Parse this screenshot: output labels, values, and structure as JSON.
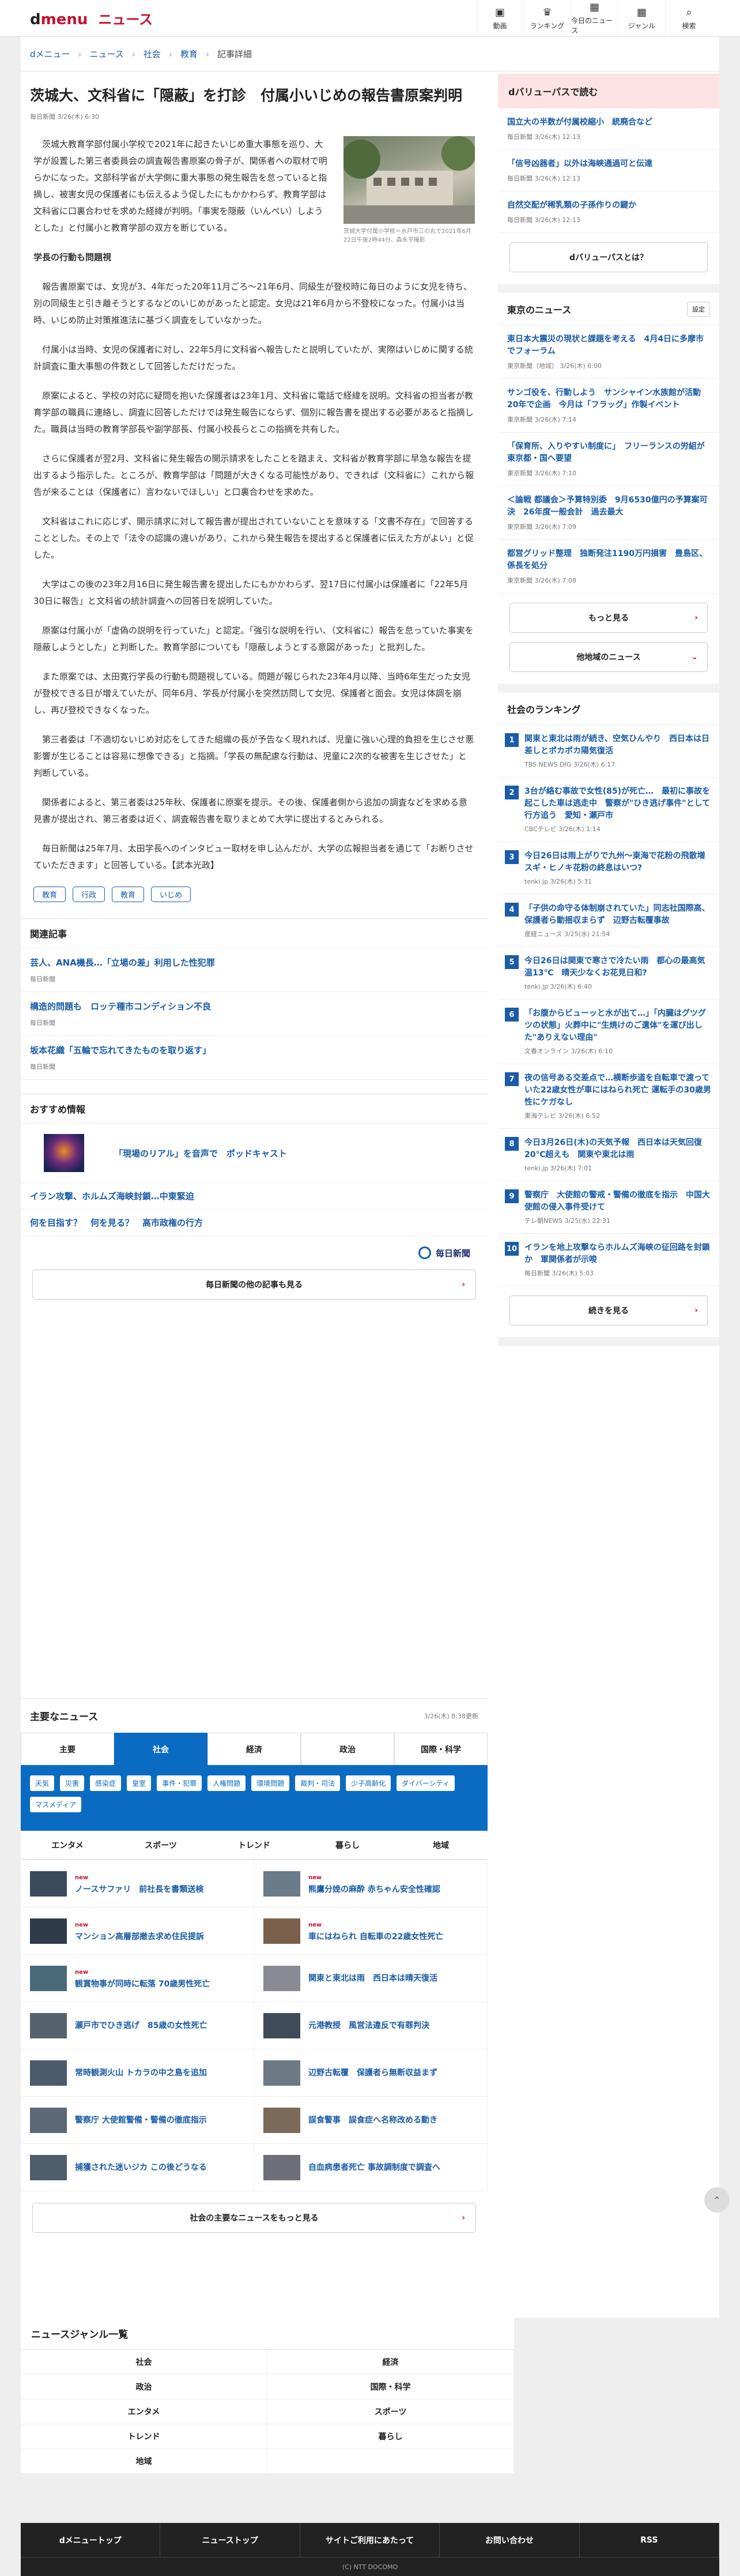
{
  "header": {
    "logo_d": "d",
    "logo_menu": "menu",
    "logo_news": "ニュース",
    "nav": [
      {
        "icon": "tv-icon",
        "glyph": "▣",
        "label": "動画"
      },
      {
        "icon": "trophy-icon",
        "glyph": "♛",
        "label": "ランキング"
      },
      {
        "icon": "calendar-icon",
        "glyph": "▦",
        "label": "今日のニュース"
      },
      {
        "icon": "grid-icon",
        "glyph": "▦",
        "label": "ジャンル"
      },
      {
        "icon": "search-icon",
        "glyph": "⌕",
        "label": "検索"
      }
    ]
  },
  "breadcrumb": [
    "dメニュー",
    "ニュース",
    "社会",
    "教育",
    "記事詳細"
  ],
  "article": {
    "title": "茨城大、文科省に「隠蔽」を打診　付属小いじめの報告書原案判明",
    "meta": "毎日新聞  3/26(木) 6:30",
    "caption": "茨城大学付属小学校＝水戸市三の丸で2021年6月22日午後2時44分、森永亨撮影",
    "paras": [
      "茨城大教育学部付属小学校で2021年に起きたいじめ重大事態を巡り、大学が設置した第三者委員会の調査報告書原案の骨子が、関係者への取材で明らかになった。文部科学省が大学側に重大事態の発生報告を怠っていると指摘し、被害女児の保護者にも伝えるよう促したにもかかわらず、教育学部は文科省に口裏合わせを求めた経緯が判明。「事実を隠蔽（いんぺい）しようとした」と付属小と教育学部の双方を断じている。",
      "学長の行動も問題視",
      "報告書原案では、女児が3、4年だった20年11月ごろ～21年6月、同級生が登校時に毎日のように女児を待ち、別の同級生と引き離そうとするなどのいじめがあったと認定。女児は21年6月から不登校になった。付属小は当時、いじめ防止対策推進法に基づく調査をしていなかった。",
      "付属小は当時、女児の保護者に対し、22年5月に文科省へ報告したと説明していたが、実際はいじめに関する統計調査に重大事態の件数として回答しただけだった。",
      "原案によると、学校の対応に疑問を抱いた保護者は23年1月、文科省に電話で経緯を説明。文科省の担当者が教育学部の職員に連絡し、調査に回答しただけでは発生報告にならず、個別に報告書を提出する必要があると指摘した。職員は当時の教育学部長や副学部長、付属小校長らとこの指摘を共有した。",
      "さらに保護者が翌2月、文科省に発生報告の開示請求をしたことを踏まえ、文科省が教育学部に早急な報告を提出するよう指示した。ところが、教育学部は「問題が大きくなる可能性があり、できれば（文科省に）これから報告が来ることは（保護者に）言わないでほしい」と口裏合わせを求めた。",
      "文科省はこれに応じず、開示請求に対して報告書が提出されていないことを意味する「文書不存在」で回答することとした。その上で「法令の認識の違いがあり、これから発生報告を提出すると保護者に伝えた方がよい」と促した。",
      "大学はこの後の23年2月16日に発生報告書を提出したにもかかわらず、翌17日に付属小は保護者に「22年5月30日に報告」と文科省の統計調査への回答日を説明していた。",
      "原案は付属小が「虚偽の説明を行っていた」と認定。「強引な説明を行い、（文科省に）報告を怠っていた事実を隠蔽しようとした」と判断した。教育学部についても「隠蔽しようとする意図があった」と批判した。",
      "また原案では、太田寛行学長の行動も問題視している。問題が報じられた23年4月以降、当時6年生だった女児が登校できる日が増えていたが、同年6月、学長が付属小を突然訪問して女児、保護者と面会。女児は体調を崩し、再び登校できなくなった。",
      "第三者委は「不適切ないじめ対応をしてきた組織の長が予告なく現れれば、児童に強い心理的負担を生じさせ悪影響が生じることは容易に想像できる」と指摘。「学長の無配慮な行動は、児童に2次的な被害を生じさせた」と判断している。",
      "関係者によると、第三者委は25年秋、保護者に原案を提示。その後、保護者側から追加の調査などを求める意見書が提出され、第三者委は近く、調査報告書を取りまとめて大学に提出するとみられる。",
      "毎日新聞は25年7月、太田学長へのインタビュー取材を申し込んだが、大学の広報担当者を通じて「お断りさせていただきます」と回答している。【武本光政】"
    ],
    "tags": [
      "教育",
      "行政",
      "教育",
      "いじめ"
    ]
  },
  "related": {
    "heading": "関連記事",
    "items": [
      {
        "title": "芸人、ANA機長…「立場の差」利用した性犯罪",
        "source": "毎日新聞"
      },
      {
        "title": "構造的問題も　ロッテ種市コンディション不良",
        "source": "毎日新聞"
      },
      {
        "title": "坂本花織「五輪で忘れてきたものを取り返す」",
        "source": "毎日新聞"
      }
    ]
  },
  "recommend": {
    "heading": "おすすめ情報",
    "podcast": "「現場のリアル」を音声で　ポッドキャスト",
    "items": [
      "イラン攻撃、ホルムズ海峡封鎖…中東緊迫",
      "何を目指す？　何を見る？　高市政権の行方"
    ],
    "publisher": "毎日新聞",
    "more": "毎日新聞の他の記事も見る"
  },
  "topnews": {
    "heading": "主要なニュース",
    "date": "3/26(木) 8:38更新",
    "tabs": [
      "主要",
      "社会",
      "経済",
      "政治",
      "国際・科学"
    ],
    "chips": [
      "天気",
      "災害",
      "感染症",
      "皇室",
      "事件・犯罪",
      "人権問題",
      "環境問題",
      "裁判・司法",
      "少子高齢化",
      "ダイバーシティ",
      "マスメディア"
    ],
    "subtabs": [
      "エンタメ",
      "スポーツ",
      "トレンド",
      "暮らし",
      "地域"
    ],
    "items": [
      {
        "new": "new",
        "title": "ノースサファリ　前社長を書類送検"
      },
      {
        "new": "new",
        "title": "熊鷹分娩の麻酔 赤ちゃん安全性確認"
      },
      {
        "new": "new",
        "title": "マンション高層部撤去求め住民提訴"
      },
      {
        "new": "new",
        "title": "車にはねられ 自転車の22歳女性死亡"
      },
      {
        "new": "new",
        "title": "観賞物事が同時に転落 70歳男性死亡"
      },
      {
        "new": "",
        "title": "関東と東北は雨　西日本は晴天復活"
      },
      {
        "new": "",
        "title": "瀬戸市でひき逃げ　85歳の女性死亡"
      },
      {
        "new": "",
        "title": "元港教授　風営法違反で有罪判決"
      },
      {
        "new": "",
        "title": "常時観測火山 トカラの中之島を追加"
      },
      {
        "new": "",
        "title": "辺野古転覆　保護者ら無断収益まず"
      },
      {
        "new": "",
        "title": "警察庁 大使館警備・警備の徹底指示"
      },
      {
        "new": "",
        "title": "誤食警事　誤食症へ名称改める動き"
      },
      {
        "new": "",
        "title": "捕獲された迷いジカ この後どうなる"
      },
      {
        "new": "",
        "title": "自血病患者死亡 事故調制度で調査へ"
      }
    ],
    "more": "社会の主要なニュースをもっと見る"
  },
  "side": {
    "dvalue": {
      "heading": "dバリューパスで読む",
      "items": [
        {
          "title": "国立大の半数が付属校縮小　統廃合など",
          "source": "毎日新聞 3/26(木) 12:13"
        },
        {
          "title": "「信号凶器者」以外は海峡通過可と伝達",
          "source": "毎日新聞 3/26(木) 12:13"
        },
        {
          "title": "自然交配が稀乳類の子孫作りの鍵か",
          "source": "毎日新聞 3/26(木) 12:13"
        }
      ],
      "button": "dバリューパスとは？"
    },
    "tokyo": {
      "heading": "東京のニュース",
      "setting": "設定",
      "items": [
        {
          "title": "東日本大震災の現状と課題を考える　4月4日に多摩市でフォーラム",
          "source": "東京新聞（地域） 3/26(木) 6:00"
        },
        {
          "title": "サンゴ役を、行動しよう　サンシャイン水族館が活動20年で企画　今月は「フラッグ」作製イベント",
          "source": "東京新聞 3/26(木) 7:14"
        },
        {
          "title": "「保育所、入りやすい制度に」　フリーランスの労組が東京都・国へ要望",
          "source": "東京新聞 3/26(木) 7:10"
        },
        {
          "title": "＜論戦 都議会＞予算特別委　9月6530億円の予算案可決　26年度一般会計　過去最大",
          "source": "東京新聞 3/26(木) 7:09"
        },
        {
          "title": "都営グリッド整理　独断発注1190万円損害　豊島区、係長を処分",
          "source": "東京新聞 3/26(木) 7:08"
        }
      ],
      "more": "もっと見る",
      "other": "他地域のニュース"
    },
    "ranking": {
      "heading": "社会のランキング",
      "items": [
        {
          "n": "1",
          "title": "関東と東北は雨が続き、空気ひんやり　西日本は日差しとポカポカ陽気復活",
          "source": "TBS NEWS DIG 3/26(木) 6:17"
        },
        {
          "n": "2",
          "title": "3台が絡む事故で女性(85)が死亡…　最初に事故を起こした車は逃走中　警察が\"ひき逃げ事件\"として行方追う　愛知・瀬戸市",
          "source": "CBCテレビ 3/26(木) 1:14"
        },
        {
          "n": "3",
          "title": "今日26日は雨上がりで九州～東海で花粉の飛散増　スギ・ヒノキ花粉の終息はいつ?",
          "source": "tenki.jp 3/26(木) 5:31"
        },
        {
          "n": "4",
          "title": "「子供の命守る体制崩されていた」同志社国際高、保護者ら動揺収まらず　辺野古転覆事故",
          "source": "産経ニュース 3/25(水) 21:54"
        },
        {
          "n": "5",
          "title": "今日26日は関東で寒さで冷たい雨　都心の最高気温13℃　晴天少なくお花見日和?",
          "source": "tenki.jp 3/26(木) 6:40"
        },
        {
          "n": "6",
          "title": "「お腹からビューッと水が出て…」「内臓はグツグツの状態」火葬中に\"生焼けのご遺体\"を運び出した\"ありえない理由\"",
          "source": "文春オンライン 3/26(木) 6:10"
        },
        {
          "n": "7",
          "title": "夜の信号ある交差点で…横断歩道を自転車で渡っていた22歳女性が車にはねられ死亡 運転手の30歳男性にケガなし",
          "source": "東海テレビ 3/26(木) 6:52"
        },
        {
          "n": "8",
          "title": "今日3月26日(木)の天気予報　西日本は天気回復　20℃超えも　関東や東北は雨",
          "source": "tenki.jp 3/26(木) 7:01"
        },
        {
          "n": "9",
          "title": "警察庁　大使館の警戒・警備の徹底を指示　中国大使館の侵入事件受けて",
          "source": "テレ朝NEWS 3/25(水) 22:31"
        },
        {
          "n": "10",
          "title": "イランを地上攻撃ならホルムズ海峡の征回路を封鎖か　軍関係者が示唆",
          "source": "毎日新聞 3/26(木) 5:03"
        }
      ],
      "more": "続きを見る"
    }
  },
  "genre": {
    "heading": "ニュースジャンル一覧",
    "items": [
      "社会",
      "経済",
      "政治",
      "国際・科学",
      "エンタメ",
      "スポーツ",
      "トレンド",
      "暮らし",
      "地域",
      ""
    ]
  },
  "footer": {
    "links": [
      "dメニュートップ",
      "ニューストップ",
      "サイトご利用にあたって",
      "お問い合わせ",
      "RSS"
    ],
    "copyright": "(C) NTT DOCOMO"
  }
}
